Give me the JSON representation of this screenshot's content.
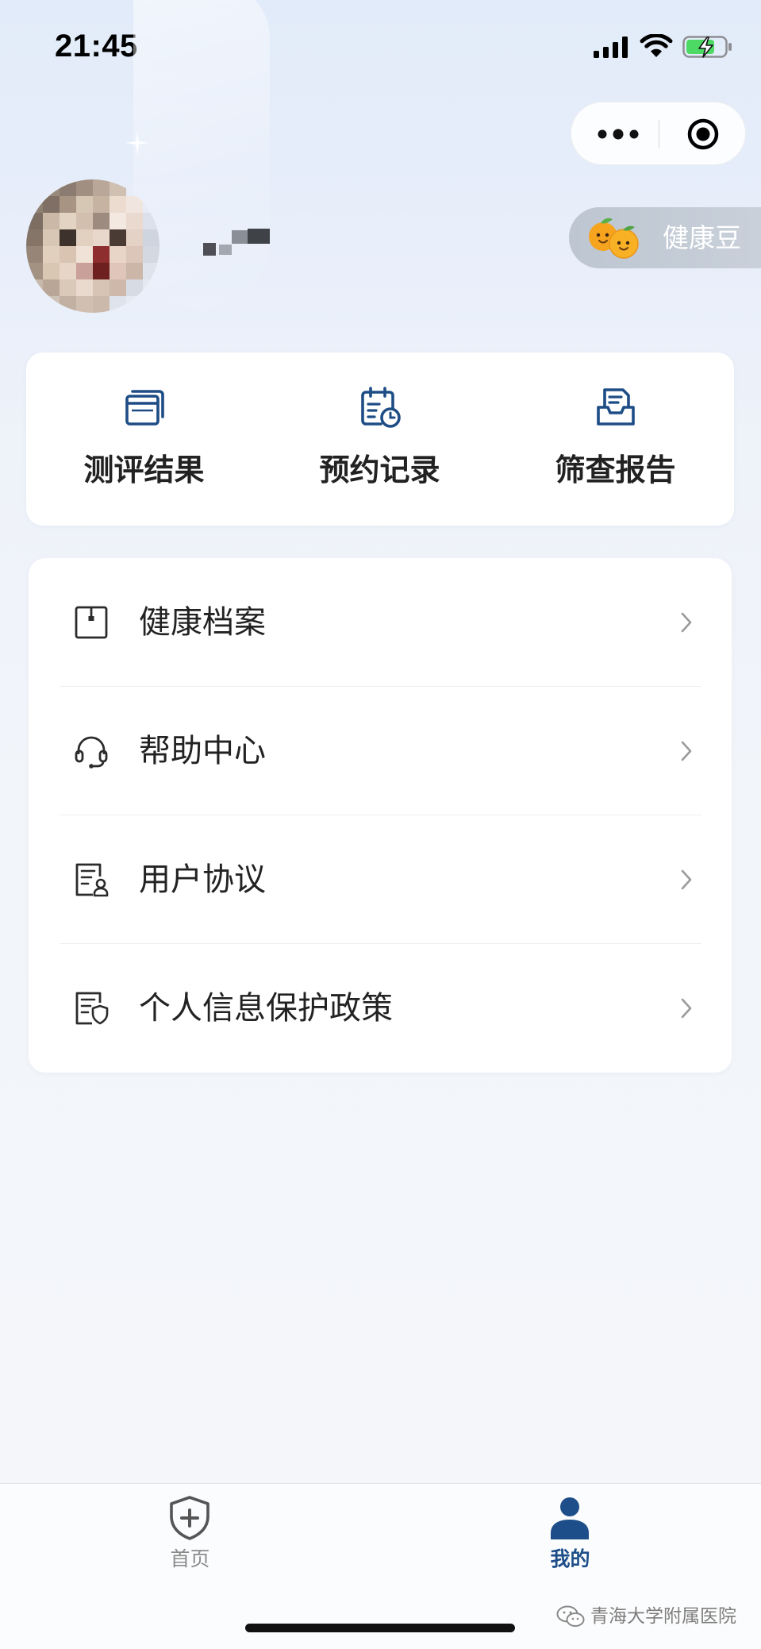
{
  "status_bar": {
    "time": "21:45",
    "icons": [
      "cellular-signal-icon",
      "wifi-icon",
      "battery-charging-icon"
    ]
  },
  "capsule": {
    "icons": [
      "more-dots-icon",
      "target-circle-icon"
    ]
  },
  "profile": {
    "avatar": {
      "mosaic": [
        [
          "#e9edf5",
          "#9a8a7e",
          "#8c7b70",
          "#a18f82",
          "#b9a89a",
          "#cfc0b2",
          "#e7edf6",
          "#e9eef7"
        ],
        [
          "#8f8074",
          "#7f6f64",
          "#a89483",
          "#d6c6b4",
          "#c7b3a1",
          "#ecdcd0",
          "#f1e6df",
          "#e6ebf5"
        ],
        [
          "#7d6e63",
          "#cbb8a6",
          "#e3d3c2",
          "#d2bfae",
          "#9e8b7f",
          "#f3e9e1",
          "#e9d9cf",
          "#dce1eb"
        ],
        [
          "#857568",
          "#d9c7b5",
          "#3d322c",
          "#e2d1c0",
          "#e8d8cb",
          "#4a3b35",
          "#e4d2c6",
          "#cfd5df"
        ],
        [
          "#978677",
          "#e2d0bf",
          "#d8c4b1",
          "#f0e2d6",
          "#8e2e2e",
          "#e9d5c8",
          "#dbc6b9",
          "#d3d8e1"
        ],
        [
          "#a39282",
          "#d9c6b3",
          "#e7d6c7",
          "#c9a19a",
          "#6e1f1f",
          "#e0c5bb",
          "#cbb6a8",
          "#dfe4ec"
        ],
        [
          "#c6b8aa",
          "#b9a696",
          "#dac8b8",
          "#e9dacd",
          "#d8c4b5",
          "#cdb8a9",
          "#d6dbe4",
          "#e5eaf2"
        ],
        [
          "#e4e8f0",
          "#cfc3b7",
          "#c2b1a2",
          "#d1c0b1",
          "#cbbaab",
          "#dfe3eb",
          "#e6ebf3",
          "#e8edf5"
        ]
      ]
    }
  },
  "health_beans": {
    "label": "健康豆",
    "icon": "orange-mascot-icon"
  },
  "quick_actions": [
    {
      "label": "测评结果",
      "icon": "window-card-icon"
    },
    {
      "label": "预约记录",
      "icon": "calendar-clock-icon"
    },
    {
      "label": "筛查报告",
      "icon": "report-tray-icon"
    }
  ],
  "menu": [
    {
      "label": "健康档案",
      "icon": "archive-box-icon"
    },
    {
      "label": "帮助中心",
      "icon": "headset-icon"
    },
    {
      "label": "用户协议",
      "icon": "document-user-icon"
    },
    {
      "label": "个人信息保护政策",
      "icon": "document-shield-icon"
    }
  ],
  "tab_bar": {
    "tabs": [
      {
        "label": "首页",
        "icon": "shield-plus-icon",
        "active": false
      },
      {
        "label": "我的",
        "icon": "person-icon",
        "active": true
      }
    ]
  },
  "watermark": {
    "text": "青海大学附属医院",
    "icon": "wechat-icon"
  },
  "colors": {
    "accent": "#1d4e89",
    "icon_blue": "#1e4d86",
    "text": "#222222",
    "muted": "#8a8a8a",
    "battery_green": "#4cd964",
    "orange": "#f5a623"
  }
}
